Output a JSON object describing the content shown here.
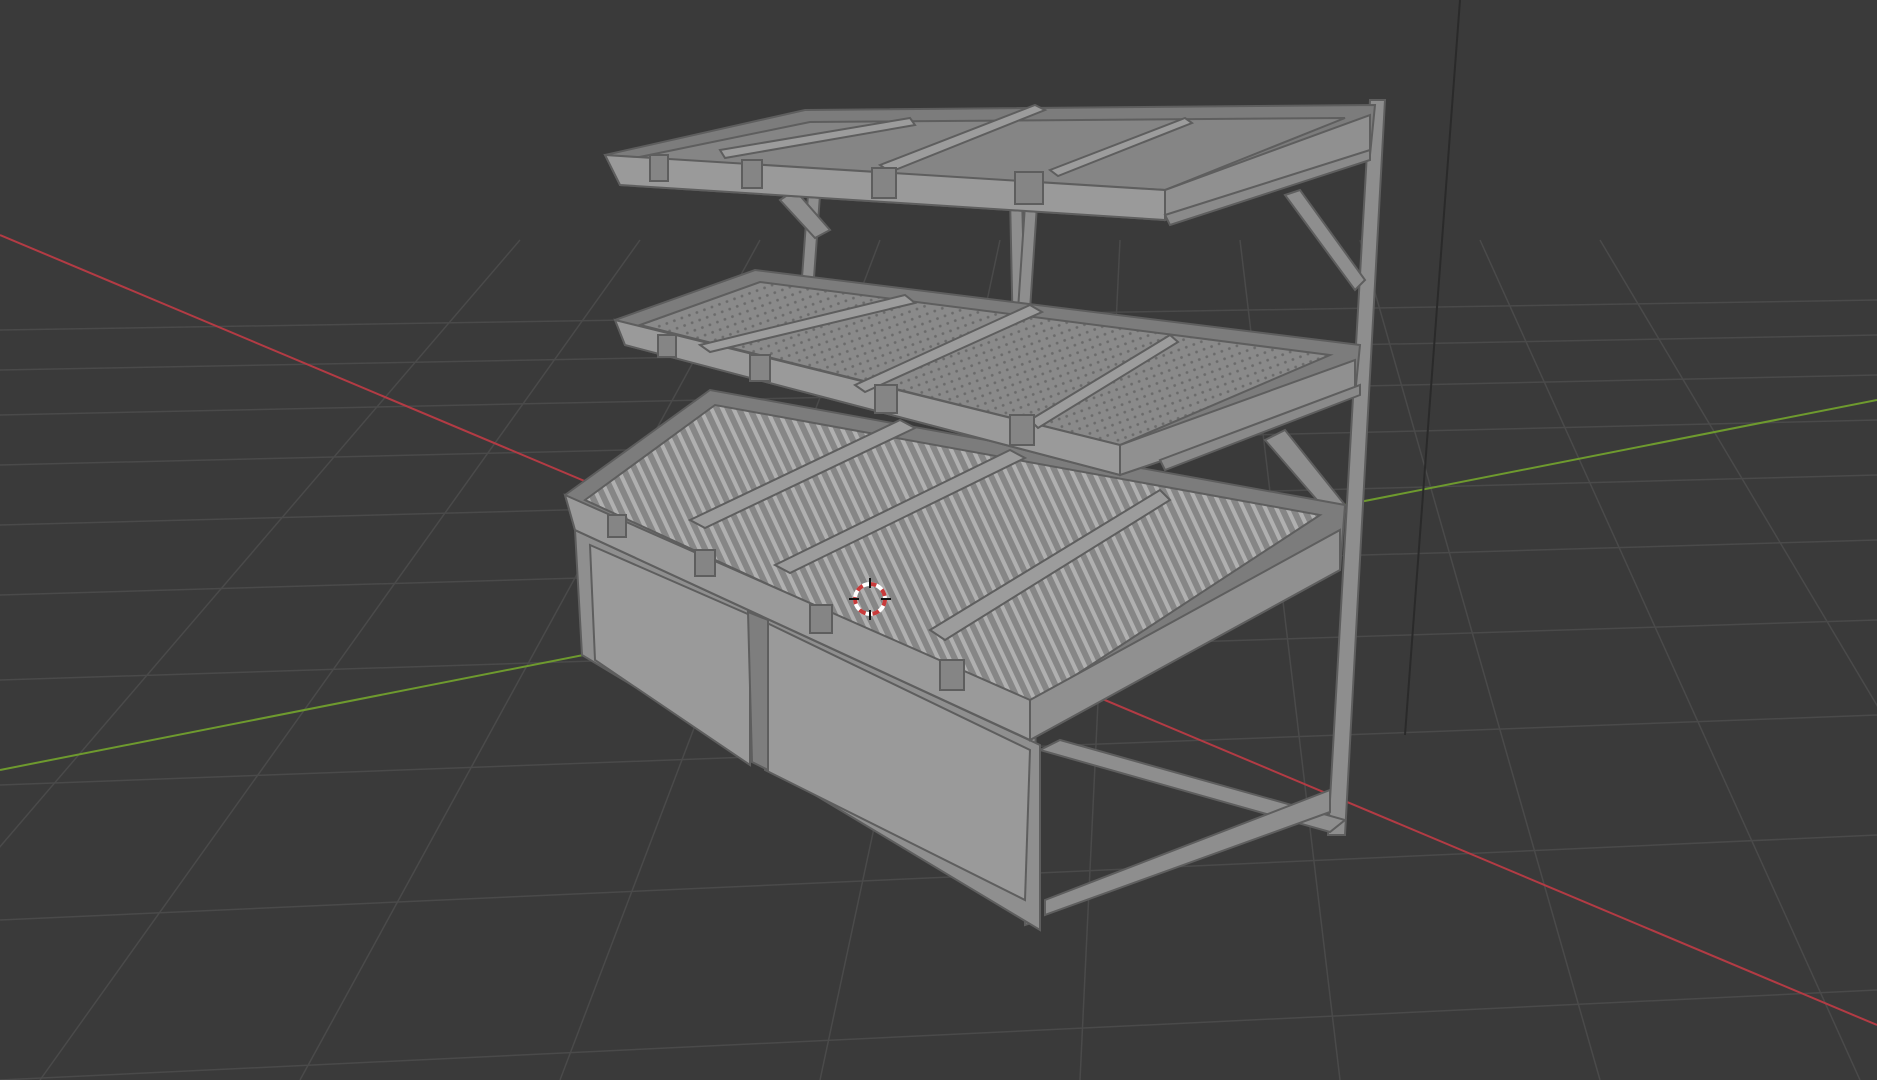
{
  "viewport": {
    "background_color": "#3a3a3a",
    "grid_color": "#4a4a4a",
    "axis_x_color": "#b33b44",
    "axis_y_color": "#6e9a2e",
    "axis_z_color": "#2c2c2c"
  },
  "model": {
    "name": "produce-display-stand",
    "shelf_count": 3,
    "base_cabinet": true,
    "surface_color": "#8e8e8e",
    "edge_color": "#5e5e5e"
  },
  "cursor": {
    "icon": "3d-cursor-icon",
    "ring_color_a": "#c83a3a",
    "ring_color_b": "#ffffff"
  }
}
